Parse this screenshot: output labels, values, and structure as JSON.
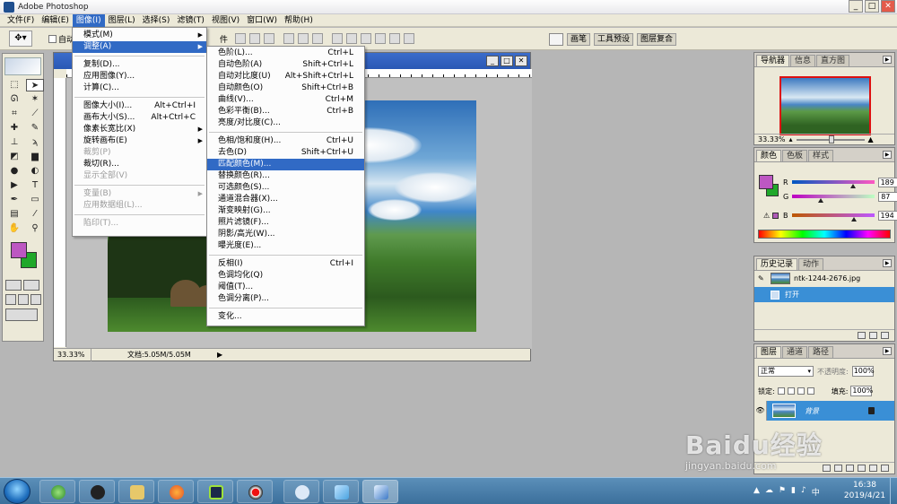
{
  "window": {
    "title": "Adobe Photoshop",
    "min": "_",
    "max": "□",
    "close": "✕"
  },
  "menubar": [
    "文件(F)",
    "编辑(E)",
    "图像(I)",
    "图层(L)",
    "选择(S)",
    "滤镜(T)",
    "视图(V)",
    "窗口(W)",
    "帮助(H)"
  ],
  "options_bar": {
    "auto_select": "自动",
    "suffix": "件",
    "palette_tabs": [
      "画笔",
      "工具预设",
      "图层复合"
    ]
  },
  "image_menu": {
    "items": [
      {
        "label": "模式(M)",
        "submenu": true
      },
      {
        "label": "调整(A)",
        "submenu": true,
        "highlighted": true
      },
      {
        "sep": true
      },
      {
        "label": "复制(D)..."
      },
      {
        "label": "应用图像(Y)..."
      },
      {
        "label": "计算(C)..."
      },
      {
        "sep": true
      },
      {
        "label": "图像大小(I)...",
        "shortcut": "Alt+Ctrl+I"
      },
      {
        "label": "画布大小(S)...",
        "shortcut": "Alt+Ctrl+C"
      },
      {
        "label": "像素长宽比(X)",
        "submenu": true
      },
      {
        "label": "旋转画布(E)",
        "submenu": true
      },
      {
        "label": "裁剪(P)",
        "disabled": true
      },
      {
        "label": "裁切(R)..."
      },
      {
        "label": "显示全部(V)",
        "disabled": true
      },
      {
        "sep": true
      },
      {
        "label": "变量(B)",
        "submenu": true,
        "disabled": true
      },
      {
        "label": "应用数据组(L)...",
        "disabled": true
      },
      {
        "sep": true
      },
      {
        "label": "陷印(T)...",
        "disabled": true
      }
    ]
  },
  "adjust_menu": {
    "items": [
      {
        "label": "色阶(L)...",
        "shortcut": "Ctrl+L"
      },
      {
        "label": "自动色阶(A)",
        "shortcut": "Shift+Ctrl+L"
      },
      {
        "label": "自动对比度(U)",
        "shortcut": "Alt+Shift+Ctrl+L"
      },
      {
        "label": "自动颜色(O)",
        "shortcut": "Shift+Ctrl+B"
      },
      {
        "label": "曲线(V)...",
        "shortcut": "Ctrl+M"
      },
      {
        "label": "色彩平衡(B)...",
        "shortcut": "Ctrl+B"
      },
      {
        "label": "亮度/对比度(C)..."
      },
      {
        "sep": true
      },
      {
        "label": "色相/饱和度(H)...",
        "shortcut": "Ctrl+U"
      },
      {
        "label": "去色(D)",
        "shortcut": "Shift+Ctrl+U"
      },
      {
        "label": "匹配颜色(M)...",
        "highlighted": true
      },
      {
        "label": "替换颜色(R)..."
      },
      {
        "label": "可选颜色(S)..."
      },
      {
        "label": "通道混合器(X)..."
      },
      {
        "label": "渐变映射(G)..."
      },
      {
        "label": "照片滤镜(F)..."
      },
      {
        "label": "阴影/高光(W)..."
      },
      {
        "label": "曝光度(E)..."
      },
      {
        "sep": true
      },
      {
        "label": "反相(I)",
        "shortcut": "Ctrl+I"
      },
      {
        "label": "色调均化(Q)"
      },
      {
        "label": "阈值(T)..."
      },
      {
        "label": "色调分离(P)..."
      },
      {
        "sep": true
      },
      {
        "label": "变化..."
      }
    ]
  },
  "document": {
    "zoom": "33.33%",
    "info": "文档:5.05M/5.05M",
    "min": "_",
    "max": "□",
    "close": "✕"
  },
  "navigator": {
    "tabs": [
      "导航器",
      "信息",
      "直方图"
    ],
    "zoom": "33.33%"
  },
  "color_panel": {
    "tabs": [
      "颜色",
      "色板",
      "样式"
    ],
    "channels": [
      {
        "label": "R",
        "value": "189",
        "level": 189
      },
      {
        "label": "G",
        "value": "87",
        "level": 87
      },
      {
        "label": "B",
        "value": "194",
        "level": 194
      }
    ],
    "foreground": "#bd57c2",
    "background": "#20a82a",
    "gamut_warning": "⚠"
  },
  "history_panel": {
    "tabs": [
      "历史记录",
      "动作"
    ],
    "snapshot": "ntk-1244-2676.jpg",
    "states": [
      "打开"
    ]
  },
  "layers_panel": {
    "tabs": [
      "图层",
      "通道",
      "路径"
    ],
    "blend_mode": "正常",
    "opacity_label": "不透明度:",
    "opacity": "100%",
    "lock_label": "锁定:",
    "fill_label": "填充:",
    "fill": "100%",
    "layer_name": "背景"
  },
  "taskbar": {
    "time": "16:38",
    "date": "2019/4/21"
  },
  "watermark": {
    "logo": "Baidu经验",
    "url": "jingyan.baidu.com"
  },
  "colors": {
    "menu_highlight": "#316ac5",
    "title_blue": "#2a58b4",
    "panel_bg": "#ece9d8",
    "selection": "#3a8fd6"
  }
}
